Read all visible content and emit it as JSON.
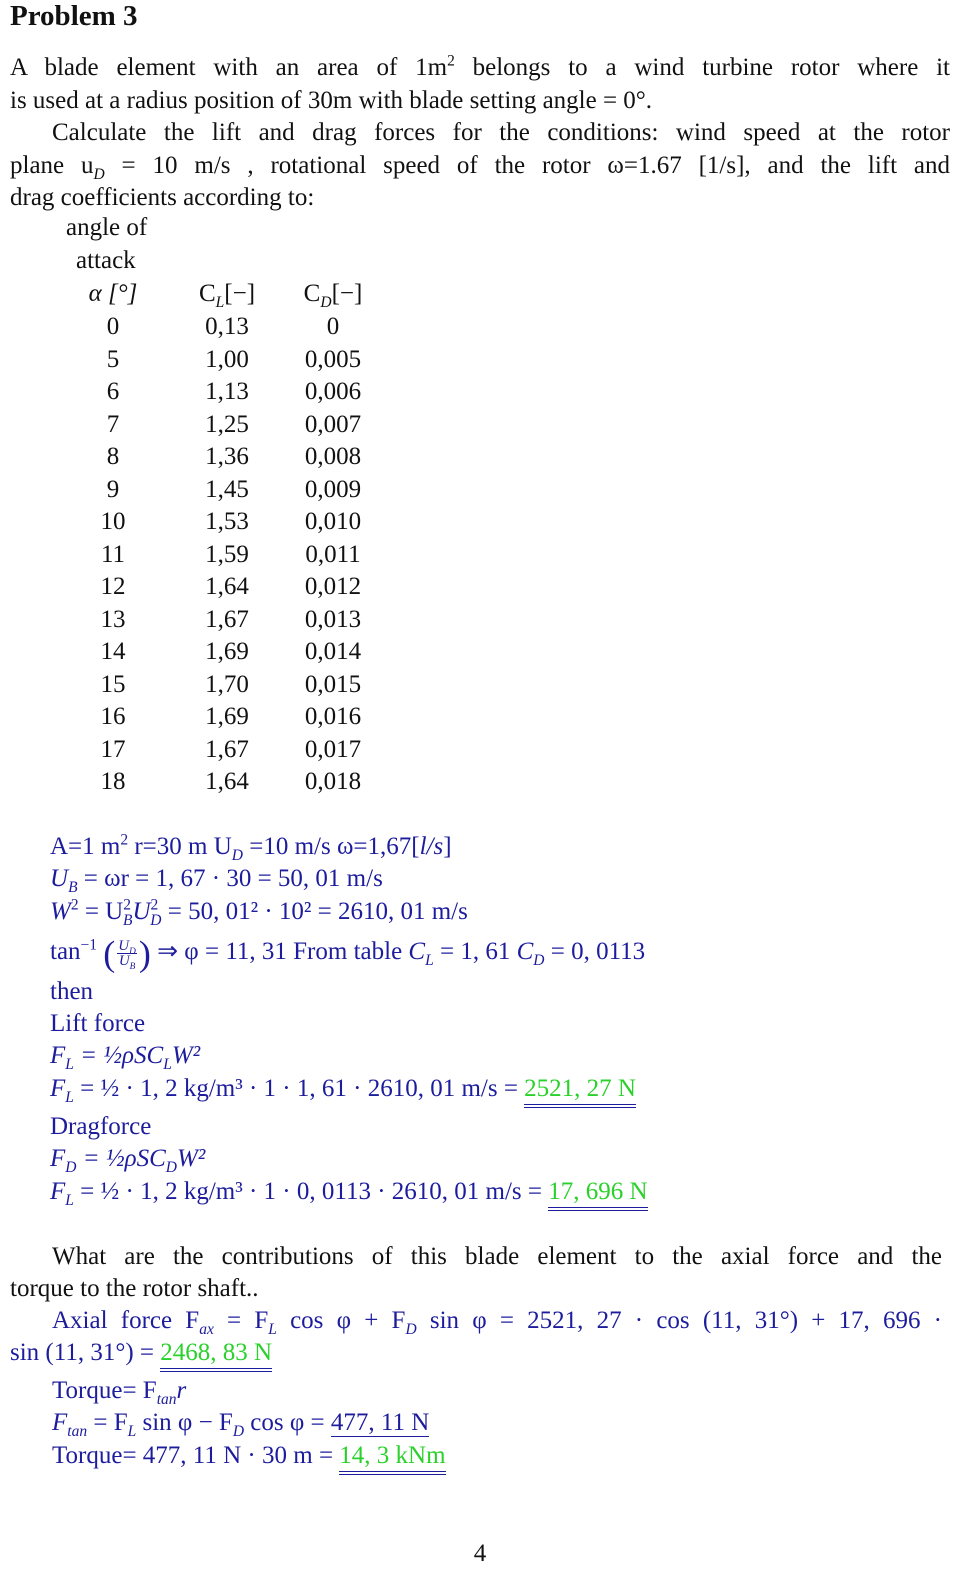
{
  "document": {
    "title": "Problem 3",
    "page_number": "4",
    "colors": {
      "text": "#111111",
      "solution": "#1c1c9c",
      "result": "#2bd12b"
    }
  },
  "problem": {
    "p1_l1": "A blade element with an area of 1m",
    "p1_l1_sup": "2",
    "p1_l1_rest": " belongs to a wind turbine rotor where it",
    "p1_l2": "is used at a radius position of 30m with blade setting angle = 0°.",
    "p2_l1": "Calculate the lift and drag forces for the conditions: wind speed at the rotor",
    "p2_l2_a": "plane u",
    "p2_l2_sub": "D",
    "p2_l2_b": " = 10 m/s , rotational speed of the rotor ω=1.67 [1/s], and the lift and",
    "p2_l3": "drag coefficients according to:"
  },
  "table": {
    "header_line1": "angle of",
    "header_line2": "attack",
    "col_alpha": "α [°]",
    "col_cl": "C",
    "col_cl_sub": "L",
    "col_cl_unit": "[−]",
    "col_cd": "C",
    "col_cd_sub": "D",
    "col_cd_unit": "[−]",
    "rows": [
      {
        "alpha": "0",
        "cl": "0,13",
        "cd": "0"
      },
      {
        "alpha": "5",
        "cl": "1,00",
        "cd": "0,005"
      },
      {
        "alpha": "6",
        "cl": "1,13",
        "cd": "0,006"
      },
      {
        "alpha": "7",
        "cl": "1,25",
        "cd": "0,007"
      },
      {
        "alpha": "8",
        "cl": "1,36",
        "cd": "0,008"
      },
      {
        "alpha": "9",
        "cl": "1,45",
        "cd": "0,009"
      },
      {
        "alpha": "10",
        "cl": "1,53",
        "cd": "0,010"
      },
      {
        "alpha": "11",
        "cl": "1,59",
        "cd": "0,011"
      },
      {
        "alpha": "12",
        "cl": "1,64",
        "cd": "0,012"
      },
      {
        "alpha": "13",
        "cl": "1,67",
        "cd": "0,013"
      },
      {
        "alpha": "14",
        "cl": "1,69",
        "cd": "0,014"
      },
      {
        "alpha": "15",
        "cl": "1,70",
        "cd": "0,015"
      },
      {
        "alpha": "16",
        "cl": "1,69",
        "cd": "0,016"
      },
      {
        "alpha": "17",
        "cl": "1,67",
        "cd": "0,017"
      },
      {
        "alpha": "18",
        "cl": "1,64",
        "cd": "0,018"
      }
    ]
  },
  "solution": {
    "given_a": "A=1 m",
    "given_a_sup": "2",
    "given_b": " r=30 m U",
    "given_b_sub": "D",
    "given_c": " =10 m/s ω=1,67[",
    "given_c_it": "l/s",
    "given_d": "]",
    "ub_lhs": "U",
    "ub_lhs_sub": "B",
    "ub_rhs": " = ωr = 1, 67 · 30 = 50, 01 m/s",
    "w2_a": "W",
    "w2_rest": " = U",
    "w2_mid": "U",
    "w2_end": " = 50, 01² · 10² = 2610, 01 m/s",
    "tan_prefix": "tan",
    "tan_sup": "−1",
    "frac_num": "U",
    "frac_num_sub": "D",
    "frac_den": "U",
    "frac_den_sub": "B",
    "tan_result": " ⇒ φ = 11, 31 From table ",
    "cl_label": "C",
    "cl_sub": "L",
    "cl_val": " = 1, 61 ",
    "cd_label": "C",
    "cd_sub": "D",
    "cd_val": " = 0, 0113",
    "then": "then",
    "lift_heading": "Lift force",
    "fl_formula_a": "F",
    "fl_formula_sub": "L",
    "fl_formula_b": " = ½ρSC",
    "fl_formula_c_sub": "L",
    "fl_formula_d": "W²",
    "fl_calc_a": "F",
    "fl_calc_sub": "L",
    "fl_calc_b": " = ½ · 1, 2 kg/m³ · 1 · 1, 61 · 2610, 01 m/s = ",
    "fl_result": "2521, 27 N",
    "drag_heading": "Dragforce",
    "fd_formula_a": "F",
    "fd_formula_sub": "D",
    "fd_formula_b": " = ½ρSC",
    "fd_formula_c_sub": "D",
    "fd_formula_d": "W²",
    "fd_calc_a": "F",
    "fd_calc_sub": "L",
    "fd_calc_b": " = ½ · 1, 2 kg/m³ · 1 · 0, 0113 · 2610, 01 m/s = ",
    "fd_result": "17, 696 N"
  },
  "question2": {
    "l1": "What are the contributions of this blade element to the axial force and the",
    "l2": "torque to the rotor shaft.."
  },
  "solution2": {
    "axial_l1": "Axial force F",
    "axial_l1_sub": "ax",
    "axial_l1_rest": " = F",
    "axial_fl_sub": "L",
    "axial_mid": " cos φ + F",
    "axial_fd_sub": "D",
    "axial_end": " sin φ = 2521, 27 · cos (11, 31°) + 17, 696 ·",
    "axial_l2": "sin (11, 31°) = ",
    "axial_result": "2468, 83 N",
    "torque_def_a": "Torque= F",
    "torque_def_sub": "tan",
    "torque_def_b": "r",
    "ftan_a": "F",
    "ftan_sub": "tan",
    "ftan_b": " = F",
    "ftan_fl_sub": "L",
    "ftan_c": " sin φ − F",
    "ftan_fd_sub": "D",
    "ftan_d": " cos φ = ",
    "ftan_result": "477, 11 N",
    "torque_calc": "Torque= 477, 11 N · 30 m = ",
    "torque_result": "14, 3 kNm"
  }
}
